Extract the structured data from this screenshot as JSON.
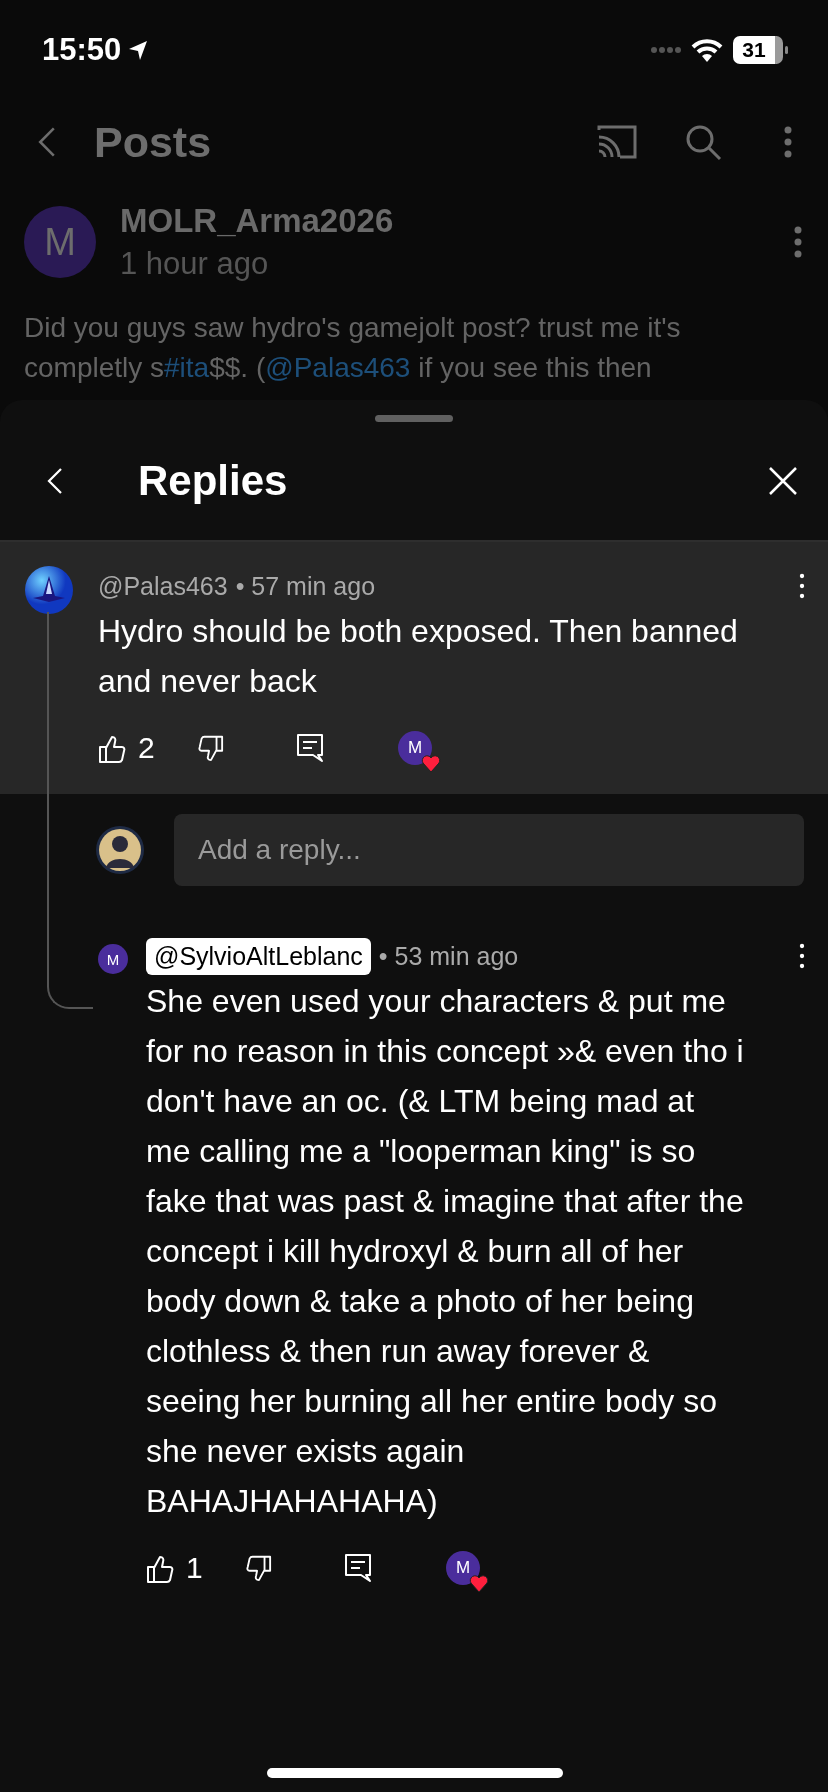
{
  "status_bar": {
    "time": "15:50",
    "battery": "31"
  },
  "header": {
    "title": "Posts"
  },
  "post": {
    "avatar_letter": "M",
    "author": "MOLR_Arma2026",
    "time": "1 hour ago",
    "text": [
      {
        "kind": "plain",
        "text": "Did you guys saw hydro's gamejolt post? trust me it's completly s"
      },
      {
        "kind": "link",
        "text": "#ita"
      },
      {
        "kind": "plain",
        "text": "$$. ("
      },
      {
        "kind": "link",
        "text": "@Palas463"
      },
      {
        "kind": "plain",
        "text": " if you see this then"
      }
    ]
  },
  "sheet": {
    "title": "Replies",
    "comment": {
      "author": "@Palas463",
      "time": "• 57 min ago",
      "text": "Hydro should be both exposed. Then banned and never back",
      "likes": "2",
      "highlighted": true,
      "author_badge": false,
      "heart_letter": "M"
    },
    "reply_field": {
      "placeholder": "Add a reply..."
    },
    "replies": [
      {
        "author": "@SylvioAltLeblanc",
        "time": "• 53 min ago",
        "text": "She even used your characters & put me for no reason in this concept »& even tho i don't have an oc. (& LTM being mad at me calling me a \"looperman king\" is so fake that was past & imagine that after the concept i kill hydroxyl & burn all of her body down & take a photo of her being clothless & then run away forever & seeing her burning all her entire body so she never exists again BAHAJHAHAHAHA)",
        "likes": "1",
        "highlighted": false,
        "author_badge": true,
        "heart_letter": "M",
        "avatar_letter": "M"
      }
    ]
  }
}
